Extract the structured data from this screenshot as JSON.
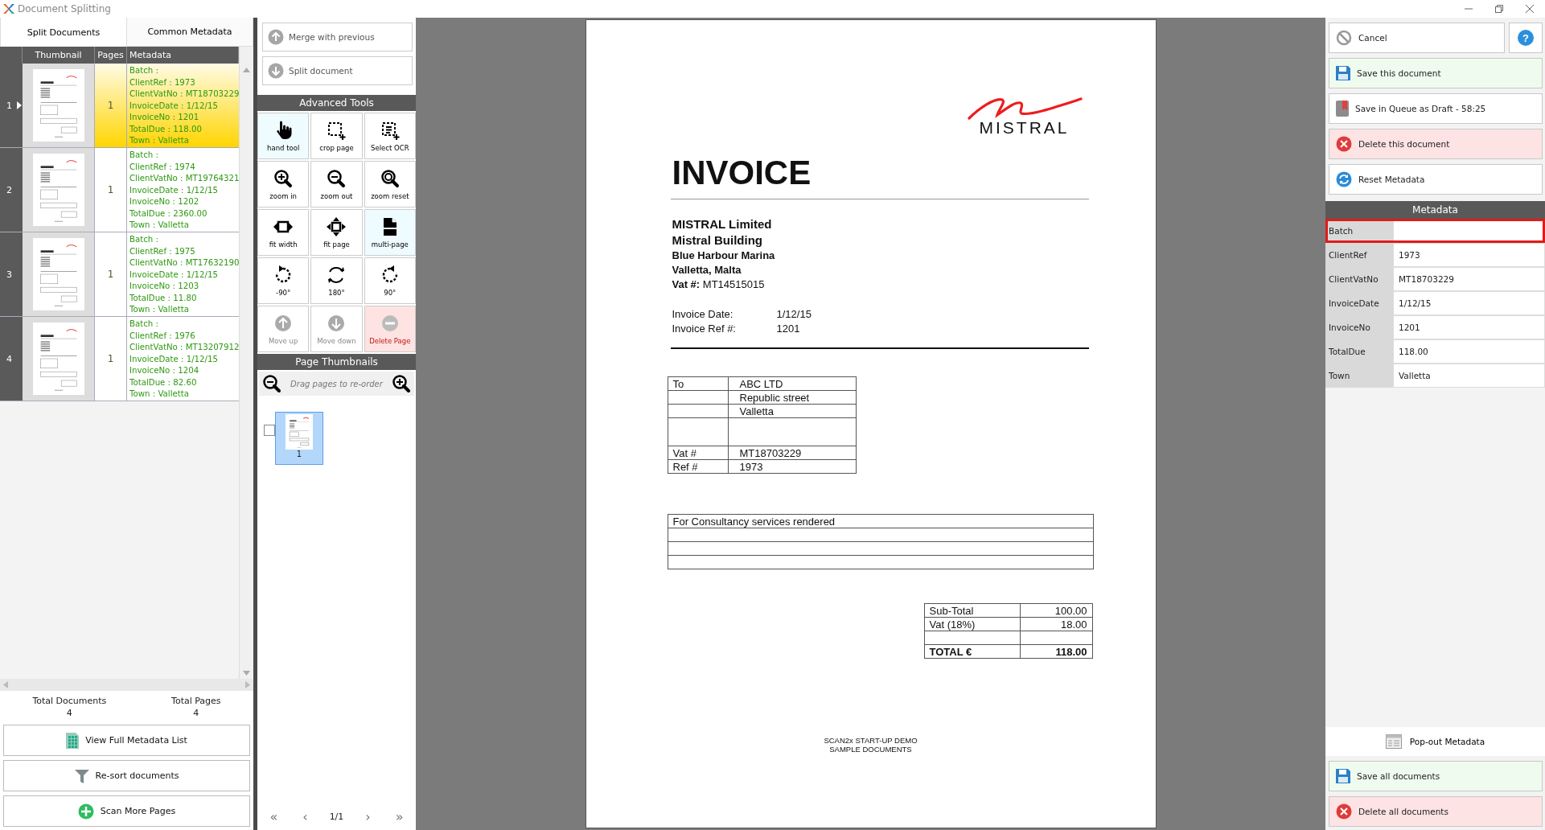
{
  "window": {
    "title": "Document Splitting"
  },
  "tabs": [
    {
      "label": "Split Documents",
      "selected": true
    },
    {
      "label": "Common Metadata",
      "selected": false
    }
  ],
  "documents": {
    "columns": [
      "Thumbnail",
      "Pages",
      "Metadata"
    ],
    "rows": [
      {
        "number": "1",
        "pages": "1",
        "selected": true,
        "metadata": [
          "Batch :",
          "ClientRef : 1973",
          "ClientVatNo : MT18703229",
          "InvoiceDate : 1/12/15",
          "InvoiceNo : 1201",
          "TotalDue : 118.00",
          "Town : Valletta"
        ]
      },
      {
        "number": "2",
        "pages": "1",
        "selected": false,
        "metadata": [
          "Batch :",
          "ClientRef : 1974",
          "ClientVatNo : MT19764321",
          "InvoiceDate : 1/12/15",
          "InvoiceNo : 1202",
          "TotalDue : 2360.00",
          "Town : Valletta"
        ]
      },
      {
        "number": "3",
        "pages": "1",
        "selected": false,
        "metadata": [
          "Batch :",
          "ClientRef : 1975",
          "ClientVatNo : MT17632190",
          "InvoiceDate : 1/12/15",
          "InvoiceNo : 1203",
          "TotalDue : 11.80",
          "Town : Valletta"
        ]
      },
      {
        "number": "4",
        "pages": "1",
        "selected": false,
        "metadata": [
          "Batch :",
          "ClientRef : 1976",
          "ClientVatNo : MT13207912",
          "InvoiceDate : 1/12/15",
          "InvoiceNo : 1204",
          "TotalDue : 82.60",
          "Town : Valletta"
        ]
      }
    ]
  },
  "totals": [
    {
      "label": "Total Documents",
      "value": "4"
    },
    {
      "label": "Total Pages",
      "value": "4"
    }
  ],
  "left_buttons": [
    {
      "label": "View Full Metadata List",
      "kind": "list"
    },
    {
      "label": "Re-sort documents",
      "kind": "filter"
    },
    {
      "label": "Scan More Pages",
      "kind": "add"
    }
  ],
  "actions": [
    {
      "label": "Merge with previous",
      "kind": "up"
    },
    {
      "label": "Split document",
      "kind": "down"
    }
  ],
  "advanced_tools": {
    "title": "Advanced Tools",
    "tools": [
      {
        "label": "hand tool",
        "kind": "hand",
        "selected": true,
        "disabled": false
      },
      {
        "label": "crop page",
        "kind": "crop",
        "selected": false,
        "disabled": false
      },
      {
        "label": "Select OCR",
        "kind": "ocr",
        "selected": false,
        "disabled": false
      },
      {
        "label": "zoom in",
        "kind": "zoom-in",
        "selected": false,
        "disabled": false
      },
      {
        "label": "zoom out",
        "kind": "zoom-out",
        "selected": false,
        "disabled": false
      },
      {
        "label": "zoom reset",
        "kind": "zoom-reset",
        "selected": false,
        "disabled": false
      },
      {
        "label": "fit width",
        "kind": "fit-width",
        "selected": false,
        "disabled": false
      },
      {
        "label": "fit page",
        "kind": "fit-page",
        "selected": false,
        "disabled": false
      },
      {
        "label": "multi-page",
        "kind": "multi-page",
        "selected": true,
        "disabled": false
      },
      {
        "label": "-90°",
        "kind": "rotate-left",
        "selected": false,
        "disabled": false
      },
      {
        "label": "180°",
        "kind": "rotate-180",
        "selected": false,
        "disabled": false
      },
      {
        "label": "90°",
        "kind": "rotate-right",
        "selected": false,
        "disabled": false
      },
      {
        "label": "Move up",
        "kind": "move-up",
        "selected": false,
        "disabled": true
      },
      {
        "label": "Move down",
        "kind": "move-down",
        "selected": false,
        "disabled": true
      },
      {
        "label": "Delete Page",
        "kind": "delete",
        "selected": false,
        "disabled": false
      }
    ]
  },
  "page_thumbnails": {
    "title": "Page Thumbnails",
    "hint": "Drag pages to re-order",
    "pages": [
      {
        "label": "1",
        "selected": true,
        "checked": false
      }
    ]
  },
  "pager": {
    "first": "«",
    "previous": "‹",
    "page": "1/1",
    "next": "›",
    "last": "»"
  },
  "invoice": {
    "logo": "MISTRAL",
    "title": "INVOICE",
    "company": [
      {
        "text": "MISTRAL Limited",
        "kind": "heading"
      },
      {
        "text": "Mistral Building",
        "kind": "heading"
      },
      {
        "text": "Blue Harbour Marina",
        "kind": "address"
      },
      {
        "text": "Valletta, Malta",
        "kind": "address"
      },
      {
        "text": "**Vat #:** MT14515015",
        "kind": "vat"
      }
    ],
    "details": [
      {
        "label": "Invoice Date:",
        "value": "1/12/15"
      },
      {
        "label": "Invoice Ref #:",
        "value": "1201"
      }
    ],
    "to_table": [
      {
        "kind": "line",
        "label": "To",
        "value": "ABC LTD"
      },
      {
        "kind": "line",
        "value": "Republic street"
      },
      {
        "kind": "line",
        "value": "Valletta"
      },
      {
        "kind": "blank"
      },
      {
        "kind": "line",
        "label": "Vat #",
        "value": "MT18703229"
      },
      {
        "kind": "line",
        "label": "Ref #",
        "value": "1973"
      }
    ],
    "description": [
      {
        "kind": "line",
        "text": "For Consultancy services rendered"
      },
      {
        "kind": "blank"
      },
      {
        "kind": "blank"
      },
      {
        "kind": "blank"
      }
    ],
    "sums": [
      {
        "kind": "line",
        "label": "Sub-Total",
        "value": "100.00"
      },
      {
        "kind": "line",
        "label": "Vat (18%)",
        "value": "18.00"
      },
      {
        "kind": "blank"
      },
      {
        "kind": "total",
        "label": "TOTAL €",
        "value": "118.00"
      }
    ],
    "footer": [
      "SCAN2x START-UP DEMO",
      "SAMPLE DOCUMENTS"
    ]
  },
  "right_buttons": [
    {
      "label": "Save this document",
      "kind": "save"
    },
    {
      "label": "Save in Queue as Draft - 58:25",
      "kind": "draft"
    },
    {
      "label": "Delete this document",
      "kind": "delete"
    },
    {
      "label": "Reset Metadata",
      "kind": "reset"
    }
  ],
  "cancel": {
    "label": "Cancel"
  },
  "help": {
    "label": "?"
  },
  "metadata": {
    "title": "Metadata",
    "fields": [
      {
        "label": "Batch",
        "highlighted": true
      },
      {
        "label": "ClientRef",
        "value": "1973",
        "highlighted": false
      },
      {
        "label": "ClientVatNo",
        "value": "MT18703229",
        "highlighted": false
      },
      {
        "label": "InvoiceDate",
        "value": "1/12/15",
        "highlighted": false
      },
      {
        "label": "InvoiceNo",
        "value": "1201",
        "highlighted": false
      },
      {
        "label": "TotalDue",
        "value": "118.00",
        "highlighted": false
      },
      {
        "label": "Town",
        "value": "Valletta",
        "highlighted": false
      }
    ]
  },
  "popout": {
    "label": "Pop-out Metadata"
  },
  "bottom_buttons": [
    {
      "label": "Save all documents",
      "kind": "save"
    },
    {
      "label": "Delete all documents",
      "kind": "delete"
    }
  ]
}
